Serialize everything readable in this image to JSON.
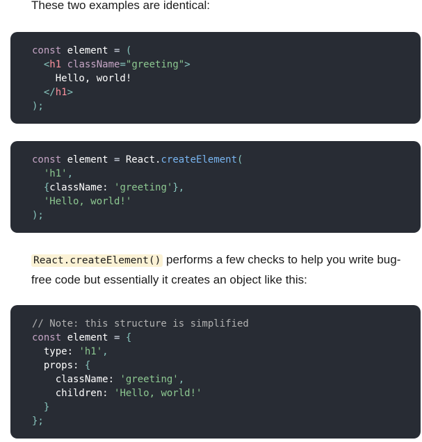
{
  "intro_text": "These two examples are identical:",
  "example_jsx": {
    "line1": {
      "kw": "const",
      "name": " element ",
      "op": "=",
      "paren": " ("
    },
    "line2": {
      "indent": "  ",
      "lt": "<",
      "tag": "h1",
      "attr": " className",
      "eq": "=",
      "val": "\"greeting\"",
      "gt": ">"
    },
    "line3": {
      "text": "    Hello, world!"
    },
    "line4": {
      "indent": "  ",
      "lt": "</",
      "tag": "h1",
      "gt": ">"
    },
    "line5": {
      "close": ");"
    }
  },
  "example_create": {
    "line1": {
      "kw": "const",
      "name": " element ",
      "op": "=",
      "obj": " React.",
      "fn": "createElement",
      "paren": "("
    },
    "line2": {
      "indent": "  ",
      "str": "'h1'",
      "comma": ","
    },
    "line3": {
      "indent": "  ",
      "open": "{",
      "key": "className: ",
      "str": "'greeting'",
      "close": "},"
    },
    "line4": {
      "indent": "  ",
      "str": "'Hello, world!'"
    },
    "line5": {
      "close": ");"
    }
  },
  "paragraph": {
    "code": "React.createElement()",
    "text": " performs a few checks to help you write bug-free code but essentially it creates an object like this:"
  },
  "example_object": {
    "line1": {
      "comment": "// Note: this structure is simplified"
    },
    "line2": {
      "kw": "const",
      "name": " element ",
      "op": "=",
      "brace": " {"
    },
    "line3": {
      "key": "  type: ",
      "str": "'h1'",
      "comma": ","
    },
    "line4": {
      "key": "  props: ",
      "brace": "{"
    },
    "line5": {
      "key": "    className: ",
      "str": "'greeting'",
      "comma": ","
    },
    "line6": {
      "key": "    children: ",
      "str": "'Hello, world!'"
    },
    "line7": {
      "brace": "  }"
    },
    "line8": {
      "close": "};"
    }
  }
}
